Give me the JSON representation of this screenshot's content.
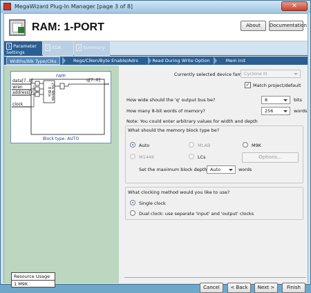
{
  "window": {
    "title": "MegaWizard Plug-In Manager [page 3 of 8]",
    "close_glyph": "✕"
  },
  "header": {
    "title": "RAM: 1-PORT",
    "about_label": "About",
    "documentation_label": "Documentation"
  },
  "tabs": [
    {
      "num": "1",
      "label": "Parameter Settings"
    },
    {
      "num": "2",
      "label": "EDA"
    },
    {
      "num": "3",
      "label": "Summary"
    }
  ],
  "subtabs": [
    "Widths/Blk Type/Clks",
    "Regs/Clken/Byte Enable/Adrs",
    "Read During Write Option",
    "Mem Init"
  ],
  "schematic": {
    "title": "ram",
    "inputs": [
      "data[7..0]",
      "wren",
      "address[7..0]",
      "clock"
    ],
    "output": "q[7..0]",
    "block_bits": "8 Bits",
    "block_words": "256 Words",
    "block_type": "Block type: AUTO"
  },
  "resource": {
    "header": "Resource Usage",
    "value": "1 M9K"
  },
  "form": {
    "device_family_label": "Currently selected device family:",
    "device_family_value": "Cyclone III",
    "match_label": "Match project/default",
    "q_width_question": "How wide should the 'q' output bus be?",
    "q_width_value": "8",
    "q_width_unit": "bits",
    "words_question": "How many 8-bit words of memory?",
    "words_value": "256",
    "words_unit": "words",
    "note": "Note: You could enter arbitrary values for width and depth",
    "block_type_question": "What should the memory block type be?",
    "block_types": {
      "auto": "Auto",
      "mlab": "MLAB",
      "m9k": "M9K",
      "m144k": "M144K",
      "lcs": "LCs"
    },
    "options_button": "Options...",
    "max_depth_label": "Set the maximum block depth to",
    "max_depth_value": "Auto",
    "max_depth_unit": "words",
    "clock_question": "What clocking method would you like to use?",
    "clock_single": "Single clock",
    "clock_dual": "Dual clock: use separate 'input' and 'output' clocks"
  },
  "footer": {
    "cancel": "Cancel",
    "back": "< Back",
    "next": "Next >",
    "finish": "Finish"
  }
}
